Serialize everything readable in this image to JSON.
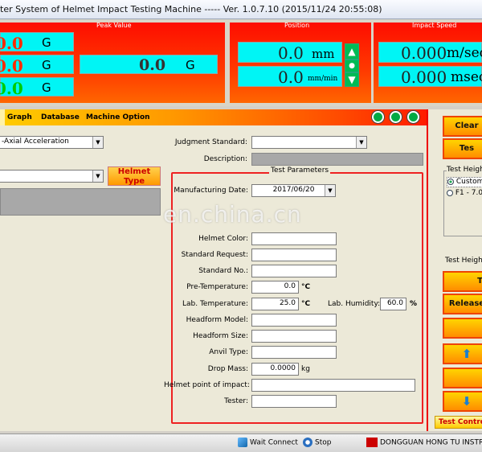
{
  "window": {
    "title": "ter System of Helmet Impact Testing Machine ----- Ver. 1.0.7.10 (2015/11/24 20:55:08)"
  },
  "peak": {
    "group_label": "Peak Value",
    "rows": [
      {
        "value": "0.0",
        "unit": "G",
        "color": "#ff2a00"
      },
      {
        "value": "0.0",
        "unit": "G",
        "color": "#ff2a00"
      },
      {
        "value": "0.0",
        "unit": "G",
        "color": "#00cc00"
      }
    ],
    "main_value": "0.0",
    "main_unit": "G"
  },
  "position": {
    "group_label": "Position",
    "pos_value": "0.0",
    "pos_unit": "mm",
    "speed_value": "0.0",
    "speed_unit": "mm/min"
  },
  "impact_speed": {
    "group_label": "Impact Speed",
    "speed_value": "0.000",
    "speed_unit": "m/sec",
    "time_value": "0.000",
    "time_unit": "msec"
  },
  "tabs": [
    "Graph",
    "Database",
    "Machine Option"
  ],
  "form": {
    "acceleration_select": "-Axial Acceleration",
    "second_select": "",
    "helmet_type_button": "Helmet Type",
    "judgment_standard_label": "Judgment Standard:",
    "judgment_standard_value": "",
    "description_label": "Description:",
    "test_params_legend": "Test Parameters",
    "fields": {
      "manufacturing_date_label": "Manufacturing Date:",
      "manufacturing_date_value": "2017/06/20",
      "helmet_color_label": "Helmet Color:",
      "standard_request_label": "Standard Request:",
      "standard_no_label": "Standard No.:",
      "pre_temperature_label": "Pre-Temperature:",
      "pre_temperature_value": "0.0",
      "pre_temperature_unit": "°C",
      "lab_temperature_label": "Lab. Temperature:",
      "lab_temperature_value": "25.0",
      "lab_temperature_unit": "°C",
      "lab_humidity_label": "Lab. Humidity:",
      "lab_humidity_value": "60.0",
      "lab_humidity_unit": "%",
      "headform_model_label": "Headform Model:",
      "headform_size_label": "Headform Size:",
      "anvil_type_label": "Anvil Type:",
      "drop_mass_label": "Drop Mass:",
      "drop_mass_value": "0.0000",
      "drop_mass_unit": "kg",
      "helmet_point_label": "Helmet point of impact:",
      "tester_label": "Tester:"
    }
  },
  "right_panel": {
    "clear_button": "Clear",
    "test_button": "Tes",
    "test_height_legend": "Test Height",
    "option_custom": "Custom",
    "option_f1": "F1 - 7.0",
    "test_height_label": "Test Height:",
    "btn_t": "T",
    "release_button": "Release",
    "btn_blank": "",
    "up_arrow": "⬆",
    "btn_blank2": "",
    "down_arrow": "⬇",
    "tab_label": "Test Control"
  },
  "status": {
    "wait_connect": "Wait Connect",
    "stop": "Stop",
    "company": "DONGGUAN HONG TU INSTRU"
  },
  "watermark": "en.china.cn"
}
